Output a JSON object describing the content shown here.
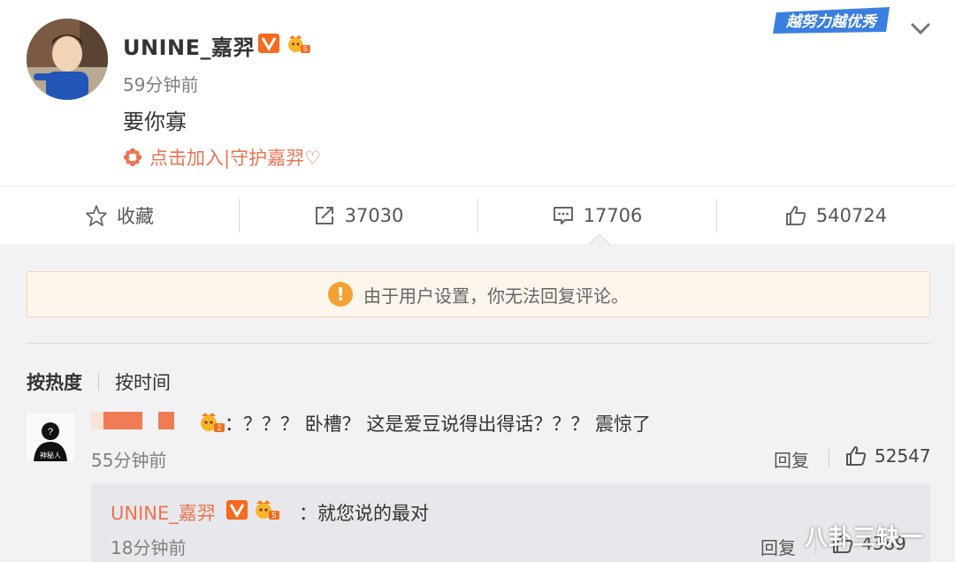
{
  "post": {
    "username": "UNINE_嘉羿",
    "time": "59分钟前",
    "text": "要你寡",
    "join_label": "点击加入|守护嘉羿♡",
    "top_badge": "越努力越优秀"
  },
  "actions": {
    "favorite": "收藏",
    "repost": "37030",
    "comment": "17706",
    "like": "540724"
  },
  "notice": "由于用户设置，你无法回复评论。",
  "sort": {
    "hot": "按热度",
    "time": "按时间"
  },
  "comment": {
    "text": "：？？？ 卧槽？ 这是爱豆说得出得话？？？ 震惊了",
    "time": "55分钟前",
    "reply_label": "回复",
    "likes": "52547",
    "avatar_text": "神秘人",
    "level_badge": "2",
    "reply": {
      "username": "UNINE_嘉羿",
      "text": "：就您说的最对",
      "time": "18分钟前",
      "reply_label": "回复",
      "likes": "4389",
      "level_badge": "5"
    }
  },
  "watermark": "八卦三缺一",
  "colors": {
    "accent": "#eb7350",
    "verified": "#f56a1d",
    "notice_bg": "#fdf6ec",
    "notice_icon": "#f5a033"
  }
}
